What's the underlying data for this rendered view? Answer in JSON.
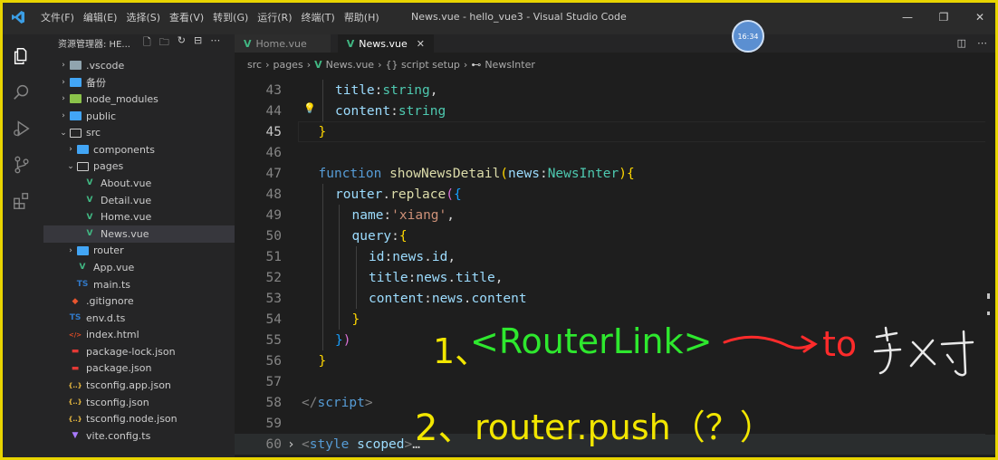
{
  "menu": [
    "文件(F)",
    "编辑(E)",
    "选择(S)",
    "查看(V)",
    "转到(G)",
    "运行(R)",
    "终端(T)",
    "帮助(H)"
  ],
  "window_title": "News.vue - hello_vue3 - Visual Studio Code",
  "clock": "16:34",
  "sidebar": {
    "header": "资源管理器: HE...",
    "items": [
      {
        "label": ".vscode",
        "kind": "folder",
        "icon": "vscode-folder-icon",
        "depth": 0,
        "chev": "›"
      },
      {
        "label": "备份",
        "kind": "folder",
        "icon": "folder-icon",
        "depth": 0,
        "chev": "›"
      },
      {
        "label": "node_modules",
        "kind": "folder",
        "icon": "node-folder-icon",
        "depth": 0,
        "chev": "›"
      },
      {
        "label": "public",
        "kind": "folder",
        "icon": "folder-icon",
        "depth": 0,
        "chev": "›"
      },
      {
        "label": "src",
        "kind": "folder-open",
        "icon": "folder-open-icon",
        "depth": 0,
        "chev": "⌄"
      },
      {
        "label": "components",
        "kind": "folder",
        "icon": "folder-icon",
        "depth": 1,
        "chev": "›"
      },
      {
        "label": "pages",
        "kind": "folder-open",
        "icon": "folder-open-icon",
        "depth": 1,
        "chev": "⌄"
      },
      {
        "label": "About.vue",
        "kind": "vue",
        "icon": "vue-file-icon",
        "depth": 2,
        "chev": ""
      },
      {
        "label": "Detail.vue",
        "kind": "vue",
        "icon": "vue-file-icon",
        "depth": 2,
        "chev": ""
      },
      {
        "label": "Home.vue",
        "kind": "vue",
        "icon": "vue-file-icon",
        "depth": 2,
        "chev": ""
      },
      {
        "label": "News.vue",
        "kind": "vue",
        "icon": "vue-file-icon",
        "depth": 2,
        "chev": "",
        "selected": true
      },
      {
        "label": "router",
        "kind": "folder",
        "icon": "folder-icon",
        "depth": 1,
        "chev": "›"
      },
      {
        "label": "App.vue",
        "kind": "vue",
        "icon": "vue-file-icon",
        "depth": 1,
        "chev": ""
      },
      {
        "label": "main.ts",
        "kind": "ts",
        "icon": "ts-file-icon",
        "depth": 1,
        "chev": ""
      },
      {
        "label": ".gitignore",
        "kind": "git",
        "icon": "git-file-icon",
        "depth": 0,
        "chev": ""
      },
      {
        "label": "env.d.ts",
        "kind": "ts",
        "icon": "ts-file-icon",
        "depth": 0,
        "chev": ""
      },
      {
        "label": "index.html",
        "kind": "html",
        "icon": "html-file-icon",
        "depth": 0,
        "chev": ""
      },
      {
        "label": "package-lock.json",
        "kind": "npm",
        "icon": "npm-file-icon",
        "depth": 0,
        "chev": ""
      },
      {
        "label": "package.json",
        "kind": "npm",
        "icon": "npm-file-icon",
        "depth": 0,
        "chev": ""
      },
      {
        "label": "tsconfig.app.json",
        "kind": "json",
        "icon": "json-file-icon",
        "depth": 0,
        "chev": ""
      },
      {
        "label": "tsconfig.json",
        "kind": "json",
        "icon": "json-file-icon",
        "depth": 0,
        "chev": ""
      },
      {
        "label": "tsconfig.node.json",
        "kind": "json",
        "icon": "json-file-icon",
        "depth": 0,
        "chev": ""
      },
      {
        "label": "vite.config.ts",
        "kind": "vite",
        "icon": "vite-file-icon",
        "depth": 0,
        "chev": ""
      }
    ]
  },
  "tabs": [
    {
      "label": "Home.vue",
      "active": false
    },
    {
      "label": "News.vue",
      "active": true
    }
  ],
  "breadcrumb": [
    "src",
    "pages",
    "News.vue",
    "{} script setup",
    "NewsInter"
  ],
  "code_lines": [
    {
      "num": "43",
      "html": "<span class='p'>title</span><span class='w'>:</span><span class='t'>string</span><span class='w'>,</span>",
      "indent": 2
    },
    {
      "num": "44",
      "html": "<span class='p'>content</span><span class='w'>:</span><span class='t'>string</span>",
      "indent": 2
    },
    {
      "num": "45",
      "html": "<span class='b1'>}</span>",
      "indent": 1,
      "current": true
    },
    {
      "num": "46",
      "html": "",
      "indent": 0
    },
    {
      "num": "47",
      "html": "<span class='k'>function</span> <span class='f'>showNewsDetail</span><span class='b1'>(</span><span class='p'>news</span><span class='w'>:</span><span class='t'>NewsInter</span><span class='b1'>)</span><span class='b1'>{</span>",
      "indent": 1
    },
    {
      "num": "48",
      "html": "<span class='p'>router</span><span class='w'>.</span><span class='f'>replace</span><span class='b2'>(</span><span class='b3'>{</span>",
      "indent": 2
    },
    {
      "num": "49",
      "html": "<span class='p'>name</span><span class='w'>:</span><span class='s'>'xiang'</span><span class='w'>,</span>",
      "indent": 3
    },
    {
      "num": "50",
      "html": "<span class='p'>query</span><span class='w'>:</span><span class='b1'>{</span>",
      "indent": 3
    },
    {
      "num": "51",
      "html": "<span class='p'>id</span><span class='w'>:</span><span class='p'>news</span><span class='w'>.</span><span class='p'>id</span><span class='w'>,</span>",
      "indent": 4
    },
    {
      "num": "52",
      "html": "<span class='p'>title</span><span class='w'>:</span><span class='p'>news</span><span class='w'>.</span><span class='p'>title</span><span class='w'>,</span>",
      "indent": 4
    },
    {
      "num": "53",
      "html": "<span class='p'>content</span><span class='w'>:</span><span class='p'>news</span><span class='w'>.</span><span class='p'>content</span>",
      "indent": 4
    },
    {
      "num": "54",
      "html": "<span class='b1'>}</span>",
      "indent": 3
    },
    {
      "num": "55",
      "html": "<span class='b3'>}</span><span class='b2'>)</span>",
      "indent": 2
    },
    {
      "num": "56",
      "html": "<span class='b1'>}</span>",
      "indent": 1
    },
    {
      "num": "57",
      "html": "",
      "indent": 0
    },
    {
      "num": "58",
      "html": "<span class='tag'>&lt;/</span><span class='tn'>script</span><span class='tag'>&gt;</span>",
      "indent": 0
    },
    {
      "num": "59",
      "html": "",
      "indent": 0
    },
    {
      "num": "60",
      "html": "<span class='tag'>&lt;</span><span class='tn'>style</span> <span class='at'>scoped</span><span class='tag'>&gt;</span><span class='w'>…</span>",
      "indent": 0,
      "fold": true
    }
  ],
  "annotations": {
    "line1_num": "1、",
    "line1_link": "<RouterLink>",
    "line1_to": "to",
    "line1_hand": "字对",
    "line2_num": "2、",
    "line2_text": "router.push（？）"
  }
}
